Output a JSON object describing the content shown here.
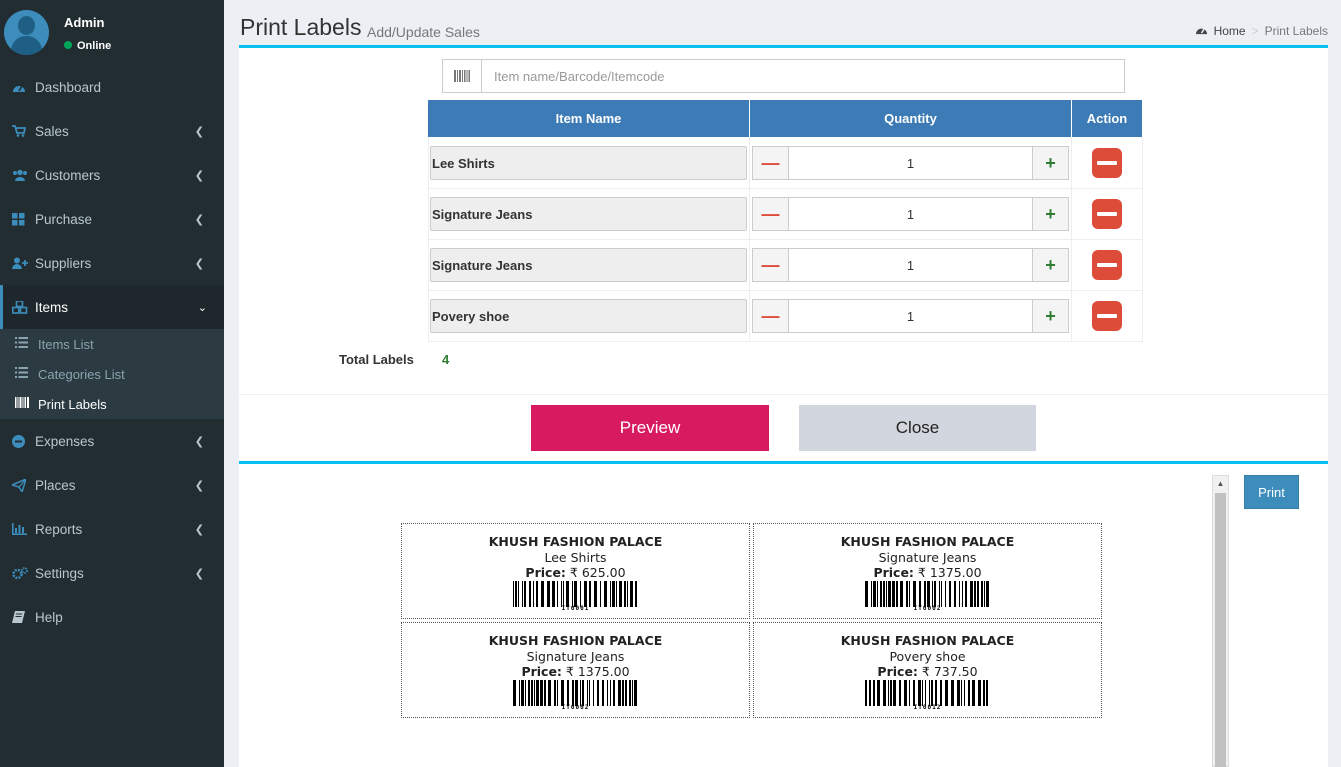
{
  "user": {
    "name": "Admin",
    "status": "Online"
  },
  "sidebar": {
    "items": [
      {
        "label": "Dashboard",
        "icon": "dashboard-icon"
      },
      {
        "label": "Sales",
        "icon": "cart-icon"
      },
      {
        "label": "Customers",
        "icon": "users-icon"
      },
      {
        "label": "Purchase",
        "icon": "grid-icon"
      },
      {
        "label": "Suppliers",
        "icon": "user-plus-icon"
      },
      {
        "label": "Items",
        "icon": "cubes-icon"
      },
      {
        "label": "Expenses",
        "icon": "minus-circle-icon"
      },
      {
        "label": "Places",
        "icon": "paper-plane-icon"
      },
      {
        "label": "Reports",
        "icon": "bar-chart-icon"
      },
      {
        "label": "Settings",
        "icon": "cogs-icon"
      },
      {
        "label": "Help",
        "icon": "book-icon"
      }
    ],
    "subitems": [
      {
        "label": "Items List",
        "icon": "list-icon"
      },
      {
        "label": "Categories List",
        "icon": "list-icon"
      },
      {
        "label": "Print Labels",
        "icon": "barcode-icon"
      }
    ]
  },
  "header": {
    "title": "Print Labels",
    "subtitle": "Add/Update Sales"
  },
  "breadcrumb": {
    "home": "Home",
    "current": "Print Labels"
  },
  "search": {
    "placeholder": "Item name/Barcode/Itemcode"
  },
  "table": {
    "headers": {
      "name": "Item Name",
      "quantity": "Quantity",
      "action": "Action"
    },
    "rows": [
      {
        "name": "Lee Shirts",
        "qty": "1"
      },
      {
        "name": "Signature Jeans",
        "qty": "1"
      },
      {
        "name": "Signature Jeans",
        "qty": "1"
      },
      {
        "name": "Povery shoe",
        "qty": "1"
      }
    ]
  },
  "totals": {
    "label": "Total Labels",
    "value": "4"
  },
  "buttons": {
    "preview": "Preview",
    "close": "Close",
    "print": "Print"
  },
  "labels": [
    {
      "shop": "KHUSH FASHION PALACE",
      "name": "Lee Shirts",
      "price_label": "Price:",
      "price": "₹ 625.00",
      "code": "IT0001"
    },
    {
      "shop": "KHUSH FASHION PALACE",
      "name": "Signature Jeans",
      "price_label": "Price:",
      "price": "₹ 1375.00",
      "code": "IT0002"
    },
    {
      "shop": "KHUSH FASHION PALACE",
      "name": "Signature Jeans",
      "price_label": "Price:",
      "price": "₹ 1375.00",
      "code": "IT0002"
    },
    {
      "shop": "KHUSH FASHION PALACE",
      "name": "Povery shoe",
      "price_label": "Price:",
      "price": "₹ 737.50",
      "code": "IT0012"
    }
  ]
}
